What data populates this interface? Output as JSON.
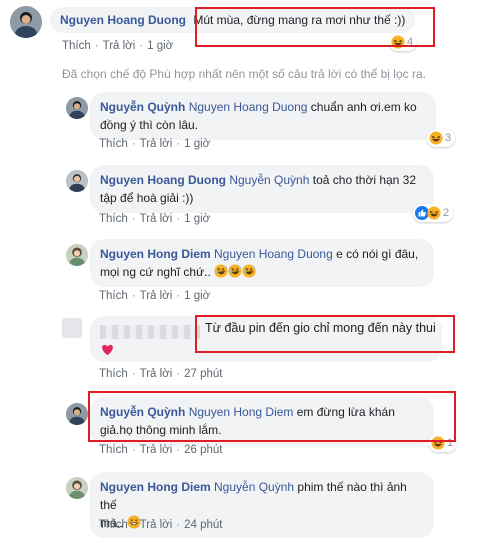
{
  "colors": {
    "link": "#385898",
    "meta": "#606770",
    "highlight": "#e01c24",
    "bubble": "#f2f3f5"
  },
  "comment_main": {
    "author": "Nguyen Hoang Duong",
    "text": "Mút mùa, đừng mang ra mơi như thế :))",
    "like_label": "Thích",
    "reply_label": "Trả lời",
    "time": "1 giờ",
    "reaction_icon": "haha-emoji-icon",
    "reaction_count": "4"
  },
  "filter_notice": "Đã chọn chế độ Phù hợp nhất nên một số câu trả lời có thể bị lọc ra.",
  "replies": [
    {
      "author": "Nguyễn Quỳnh",
      "mention": "Nguyen Hoang Duong",
      "text_line1": "chuẩn anh ơi.em ko",
      "text_line2": "đồng ý thì còn lâu.",
      "like_label": "Thích",
      "reply_label": "Trả lời",
      "time": "1 giờ",
      "reaction_count": "3"
    },
    {
      "author": "Nguyen Hoang Duong",
      "mention": "Nguyễn Quỳnh",
      "text_line1": "toả cho thời hạn 32",
      "text_line2": "tập để hoà giải :))",
      "like_label": "Thích",
      "reply_label": "Trả lời",
      "time": "1 giờ",
      "reaction_count": "2"
    },
    {
      "author": "Nguyen Hong Diem",
      "mention": "Nguyen Hoang Duong",
      "text_line1": "e có nói gì đâu,",
      "text_line2": "mọi ng cứ nghĩ chứ..",
      "like_label": "Thích",
      "reply_label": "Trả lời",
      "time": "1 giờ"
    },
    {
      "text_line1": "Từ đầu pin đến gio chỉ mong đến này thui",
      "like_label": "Thích",
      "reply_label": "Trả lời",
      "time": "27 phút"
    },
    {
      "author": "Nguyễn Quỳnh",
      "mention": "Nguyen Hong Diem",
      "text_line1": "em đừng lừa khán",
      "text_line2": "giả.họ thông minh lắm.",
      "like_label": "Thích",
      "reply_label": "Trả lời",
      "time": "26 phút",
      "reaction_count": "1"
    },
    {
      "author": "Nguyen Hong Diem",
      "mention": "Nguyễn Quỳnh",
      "text_line1": "phim thế nào thì ảnh thế",
      "text_line2": "mà..",
      "like_label": "Thích",
      "reply_label": "Trả lời",
      "time": "24 phút"
    }
  ]
}
